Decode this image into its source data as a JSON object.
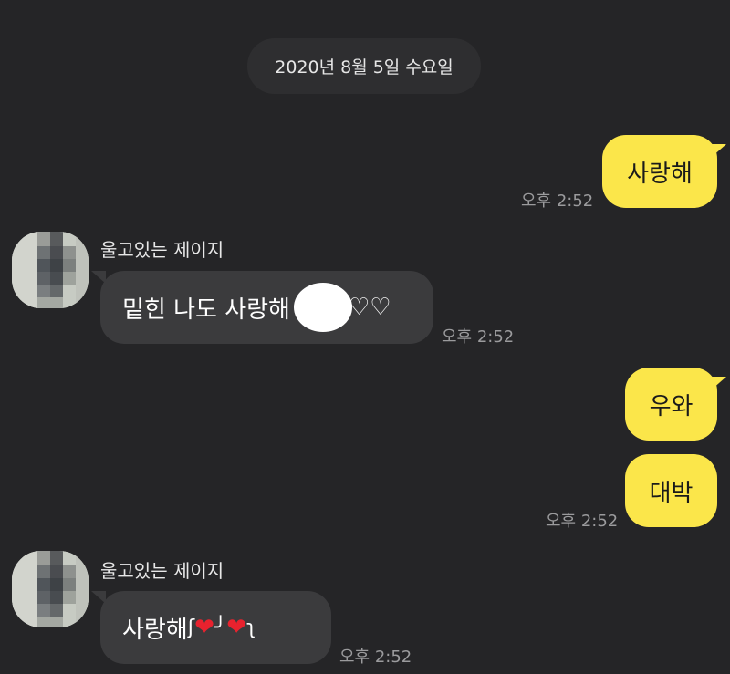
{
  "date_divider": "2020년 8월 5일 수요일",
  "messages": [
    {
      "side": "mine",
      "text": "사랑해",
      "time": "오후 2:52"
    },
    {
      "side": "theirs",
      "sender": "울고있는 제이지",
      "text_before": "밑힌 나도 사랑해",
      "text_after": "♡♡",
      "time": "오후 2:52"
    },
    {
      "side": "mine",
      "text": "우와"
    },
    {
      "side": "mine",
      "text": "대박",
      "time": "오후 2:52"
    },
    {
      "side": "theirs",
      "sender": "울고있는 제이지",
      "text_parts": [
        "사랑해",
        "ʃ",
        "❤",
        "╯",
        "❤",
        "ʅ"
      ],
      "time": "오후 2:52"
    }
  ],
  "colors": {
    "background": "#252527",
    "my_bubble": "#fbe64a",
    "their_bubble": "#3b3b3d",
    "time": "#9b9b9d"
  }
}
